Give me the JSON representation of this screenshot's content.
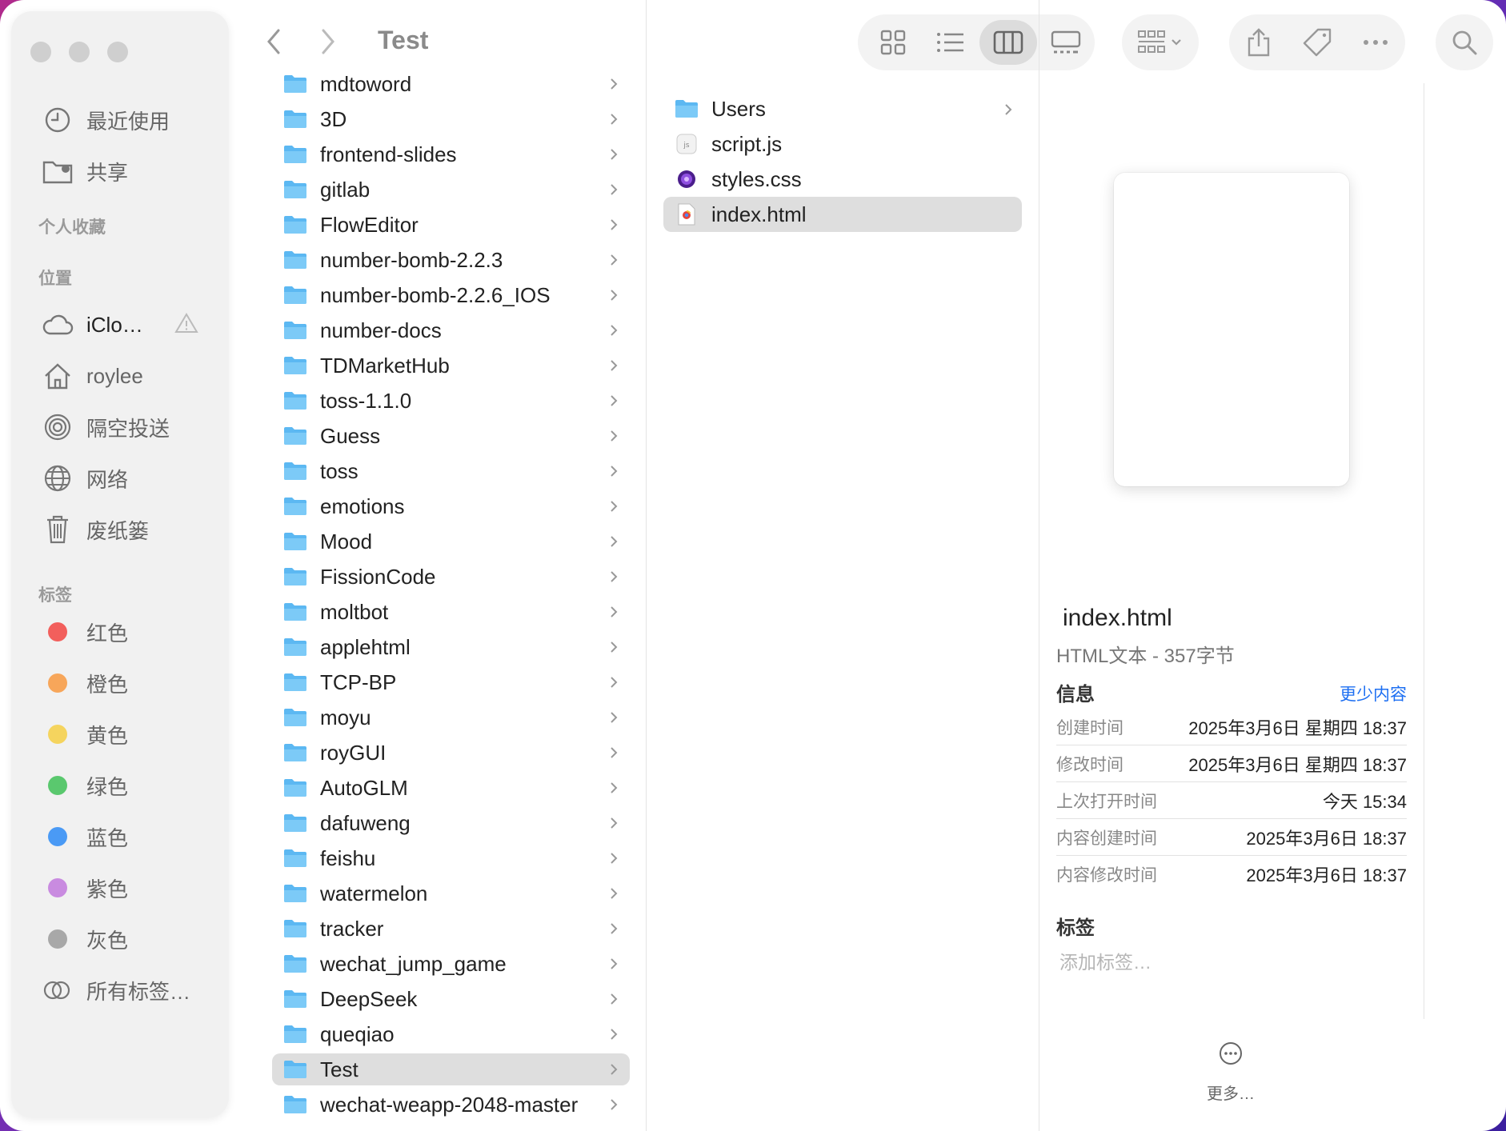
{
  "window": {
    "title": "Test"
  },
  "sidebar": {
    "top_items": [
      {
        "label": "最近使用",
        "icon": "clock-icon"
      },
      {
        "label": "共享",
        "icon": "shared-folder-icon"
      }
    ],
    "favorites_heading": "个人收藏",
    "locations_heading": "位置",
    "locations": [
      {
        "label": "iClo…",
        "icon": "icloud-icon",
        "warning": "warning-icon"
      },
      {
        "label": "roylee",
        "icon": "home-icon"
      },
      {
        "label": "隔空投送",
        "icon": "airdrop-icon"
      },
      {
        "label": "网络",
        "icon": "globe-icon"
      },
      {
        "label": "废纸篓",
        "icon": "trash-icon"
      }
    ],
    "tags_heading": "标签",
    "tags": [
      {
        "label": "红色",
        "color": "#f25f5c"
      },
      {
        "label": "橙色",
        "color": "#f7a65a"
      },
      {
        "label": "黄色",
        "color": "#f5d45e"
      },
      {
        "label": "绿色",
        "color": "#5ac86e"
      },
      {
        "label": "蓝色",
        "color": "#4a9af5"
      },
      {
        "label": "紫色",
        "color": "#c98be0"
      },
      {
        "label": "灰色",
        "color": "#a8a8a8"
      }
    ],
    "all_tags": "所有标签…"
  },
  "toolbar": {
    "view_buttons": [
      "icon-view-icon",
      "list-view-icon",
      "column-view-icon",
      "gallery-view-icon"
    ],
    "active_view": "column-view-icon"
  },
  "column1": {
    "items": [
      "mdtoword",
      "3D",
      "frontend-slides",
      "gitlab",
      "FlowEditor",
      "number-bomb-2.2.3",
      "number-bomb-2.2.6_IOS",
      "number-docs",
      "TDMarketHub",
      "toss-1.1.0",
      "Guess",
      "toss",
      "emotions",
      "Mood",
      "FissionCode",
      "moltbot",
      "applehtml",
      "TCP-BP",
      "moyu",
      "royGUI",
      "AutoGLM",
      "dafuweng",
      "feishu",
      "watermelon",
      "tracker",
      "wechat_jump_game",
      "DeepSeek",
      "queqiao",
      "Test",
      "wechat-weapp-2048-master"
    ],
    "selected": "Test"
  },
  "column2": {
    "items": [
      {
        "name": "Users",
        "type": "folder"
      },
      {
        "name": "script.js",
        "type": "js"
      },
      {
        "name": "styles.css",
        "type": "css"
      },
      {
        "name": "index.html",
        "type": "html"
      }
    ],
    "selected": "index.html"
  },
  "preview": {
    "name": "index.html",
    "kind": "HTML文本 - 357字节",
    "info_heading": "信息",
    "show_less": "更少内容",
    "info": [
      {
        "key": "创建时间",
        "value": "2025年3月6日 星期四 18:37"
      },
      {
        "key": "修改时间",
        "value": "2025年3月6日 星期四 18:37"
      },
      {
        "key": "上次打开时间",
        "value": "今天 15:34"
      },
      {
        "key": "内容创建时间",
        "value": "2025年3月6日 18:37"
      },
      {
        "key": "内容修改时间",
        "value": "2025年3月6日 18:37"
      }
    ],
    "tags_heading": "标签",
    "tags_placeholder": "添加标签…",
    "more": "更多…"
  }
}
